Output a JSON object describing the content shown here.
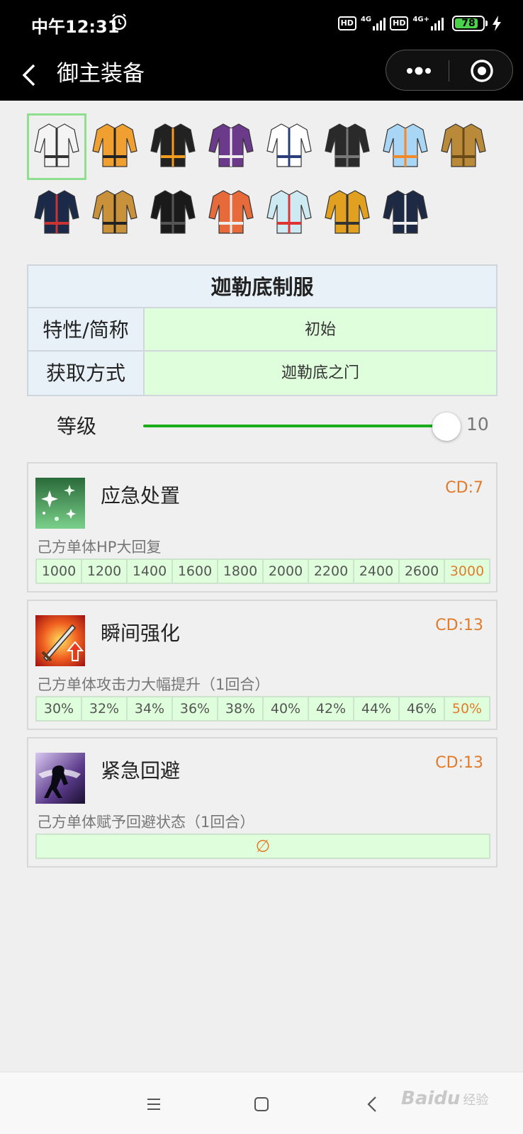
{
  "status_bar": {
    "time": "中午12:31",
    "hd1": "HD",
    "net1": "4G",
    "hd2": "HD",
    "net2": "4G+",
    "battery": "78"
  },
  "nav": {
    "title": "御主装备"
  },
  "outfits": [
    {
      "name": "outfit-1",
      "color": "#f4f4f4",
      "accent": "#333"
    },
    {
      "name": "outfit-2",
      "color": "#f0a030",
      "accent": "#222"
    },
    {
      "name": "outfit-3",
      "color": "#222",
      "accent": "#f39c1e"
    },
    {
      "name": "outfit-4",
      "color": "#6c3a8a",
      "accent": "#eee"
    },
    {
      "name": "outfit-5",
      "color": "#fff",
      "accent": "#2a3f7a"
    },
    {
      "name": "outfit-6",
      "color": "#2a2a2a",
      "accent": "#777"
    },
    {
      "name": "outfit-7",
      "color": "#a9d6f5",
      "accent": "#f08a2a"
    },
    {
      "name": "outfit-8",
      "color": "#b88a3a",
      "accent": "#6b4a1a"
    },
    {
      "name": "outfit-9",
      "color": "#1c2a4a",
      "accent": "#c33"
    },
    {
      "name": "outfit-10",
      "color": "#c8913a",
      "accent": "#222"
    },
    {
      "name": "outfit-11",
      "color": "#1a1a1a",
      "accent": "#555"
    },
    {
      "name": "outfit-12",
      "color": "#e66a3a",
      "accent": "#eee"
    },
    {
      "name": "outfit-13",
      "color": "#cde9f2",
      "accent": "#d33"
    },
    {
      "name": "outfit-14",
      "color": "#e2a020",
      "accent": "#333"
    },
    {
      "name": "outfit-15",
      "color": "#1e2a44",
      "accent": "#eee"
    }
  ],
  "selected_outfit": 0,
  "info": {
    "title": "迦勒底制服",
    "rows": [
      {
        "key": "特性/简称",
        "value": "初始"
      },
      {
        "key": "获取方式",
        "value": "迦勒底之门"
      }
    ]
  },
  "level": {
    "label": "等级",
    "value": "10",
    "max": 10,
    "current": 10
  },
  "skills": [
    {
      "name": "应急处置",
      "cd": "CD:7",
      "desc": "己方单体HP大回复",
      "values": [
        "1000",
        "1200",
        "1400",
        "1600",
        "1800",
        "2000",
        "2200",
        "2400",
        "2600",
        "3000"
      ],
      "icon_name": "heal-sparkle-icon"
    },
    {
      "name": "瞬间强化",
      "cd": "CD:13",
      "desc": "己方单体攻击力大幅提升（1回合）",
      "values": [
        "30%",
        "32%",
        "34%",
        "36%",
        "38%",
        "40%",
        "42%",
        "44%",
        "46%",
        "50%"
      ],
      "icon_name": "sword-up-icon"
    },
    {
      "name": "紧急回避",
      "cd": "CD:13",
      "desc": "己方单体赋予回避状态（1回合）",
      "values": [],
      "null_symbol": "∅",
      "icon_name": "evade-icon"
    }
  ],
  "watermark": {
    "brand": "Baidu",
    "suffix": "经验"
  }
}
